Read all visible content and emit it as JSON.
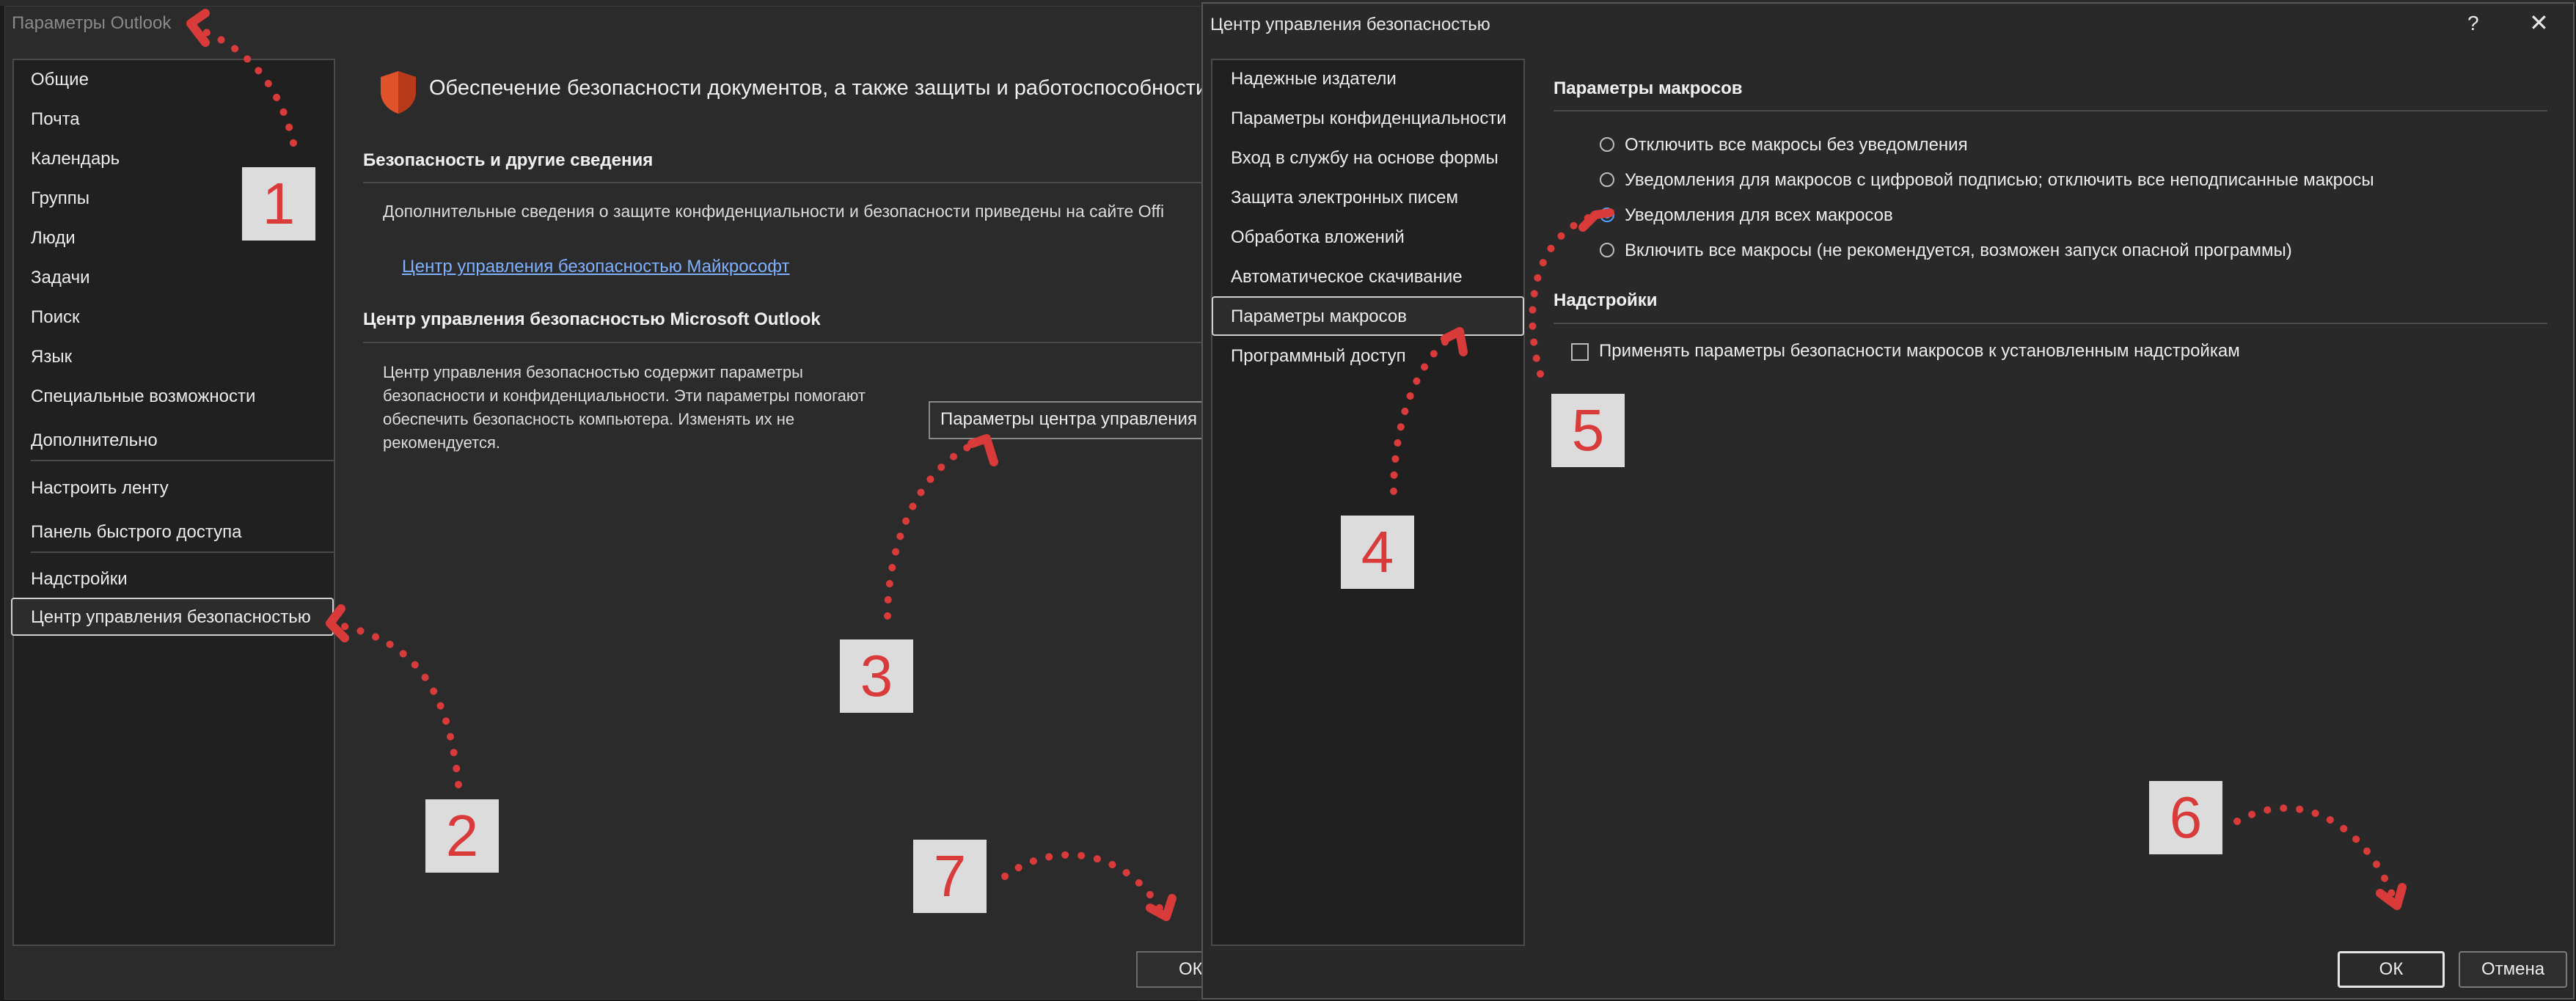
{
  "outlook_options": {
    "title": "Параметры Outlook",
    "nav": [
      "Общие",
      "Почта",
      "Календарь",
      "Группы",
      "Люди",
      "Задачи",
      "Поиск",
      "Язык",
      "Специальные возможности",
      "Дополнительно",
      "Настроить ленту",
      "Панель быстрого доступа",
      "Надстройки",
      "Центр управления безопасностью"
    ],
    "nav_selected": "Центр управления безопасностью",
    "header": "Обеспечение безопасности документов, а также защиты и работоспособности комп",
    "section1_title": "Безопасность и другие сведения",
    "section1_text": "Дополнительные сведения о защите конфиденциальности и безопасности приведены на сайте Offi",
    "ms_link": "Центр управления безопасностью Майкрософт",
    "section2_title": "Центр управления безопасностью Microsoft Outlook",
    "section2_text": [
      "Центр управления безопасностью содержит параметры",
      "безопасности и конфиденциальности. Эти параметры помогают",
      "обеспечить безопасность компьютера. Изменять их не",
      "рекомендуется."
    ],
    "trust_center_button": "Параметры центра управления",
    "ok": "ОК"
  },
  "trust_center": {
    "title": "Центр управления безопасностью",
    "help": "?",
    "close": "✕",
    "nav": [
      "Надежные издатели",
      "Параметры конфиденциальности",
      "Вход в службу на основе формы",
      "Защита электронных писем",
      "Обработка вложений",
      "Автоматическое скачивание",
      "Параметры макросов",
      "Программный доступ"
    ],
    "nav_selected": "Параметры макросов",
    "macros_title": "Параметры макросов",
    "macro_options": [
      {
        "label": "Отключить все макросы без уведомления",
        "checked": false
      },
      {
        "label": "Уведомления для макросов с цифровой подписью; отключить все неподписанные макросы",
        "checked": false
      },
      {
        "label": "Уведомления для всех макросов",
        "checked": true
      },
      {
        "label": "Включить все макросы (не рекомендуется, возможен запуск опасной программы)",
        "checked": false
      }
    ],
    "addins_title": "Надстройки",
    "addins_option": "Применять параметры безопасности макросов к установленным надстройкам",
    "addins_checked": false,
    "ok": "ОК",
    "cancel": "Отмена"
  },
  "steps": [
    "1",
    "2",
    "3",
    "4",
    "5",
    "6",
    "7"
  ],
  "colors": {
    "accent": "#4ea1ff",
    "annotation": "#d93a3a",
    "shield": "#e0522a"
  },
  "icons": {
    "shield": "shield-icon",
    "help": "help-icon",
    "close": "close-icon"
  }
}
